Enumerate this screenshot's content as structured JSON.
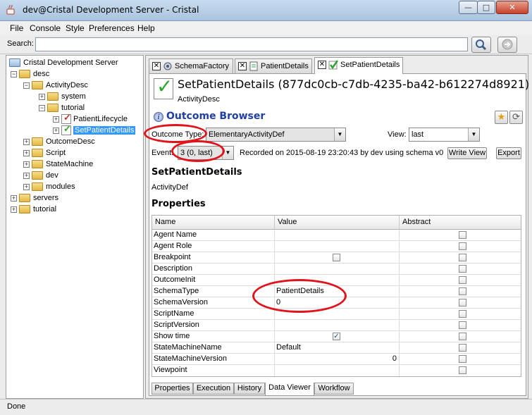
{
  "window": {
    "title": "dev@Cristal Development Server - Cristal",
    "buttons": {
      "minimize": "—",
      "maximize": "□",
      "close": "✕"
    }
  },
  "menubar": {
    "items": [
      "File",
      "Console",
      "Style",
      "Preferences",
      "Help"
    ]
  },
  "search": {
    "label": "Search:",
    "value": "",
    "placeholder": ""
  },
  "tree": {
    "root": "Cristal Development Server",
    "nodes": [
      {
        "label": "desc"
      },
      {
        "label": "ActivityDesc"
      },
      {
        "label": "system"
      },
      {
        "label": "tutorial"
      },
      {
        "label": "PatientLifecycle"
      },
      {
        "label": "SetPatientDetails"
      },
      {
        "label": "OutcomeDesc"
      },
      {
        "label": "Script"
      },
      {
        "label": "StateMachine"
      },
      {
        "label": "dev"
      },
      {
        "label": "modules"
      },
      {
        "label": "servers"
      },
      {
        "label": "tutorial"
      }
    ]
  },
  "tabs": [
    {
      "label": "SchemaFactory",
      "close": "✕"
    },
    {
      "label": "PatientDetails",
      "close": "✕"
    },
    {
      "label": "SetPatientDetails",
      "close": "✕"
    }
  ],
  "header": {
    "title": "SetPatientDetails (877dc0cb-c7db-4235-ba42-b612274d8921)",
    "subtitle": "ActivityDesc"
  },
  "outcome_browser": {
    "title": "Outcome Browser",
    "info_glyph": "i",
    "star_glyph": "★",
    "refresh_glyph": "⟳",
    "outcome_type_label": "Outcome Type:",
    "outcome_type_value": "ElementaryActivityDef",
    "view_label": "View:",
    "view_value": "last",
    "event_label": "Event:",
    "event_value": "3 (0, last)",
    "recorded_text": "Recorded on 2015-08-19 23:20:43 by dev using schema v0",
    "write_view_label": "Write View",
    "export_label": "Export",
    "dropdown_glyph": "▼"
  },
  "record": {
    "name": "SetPatientDetails",
    "type": "ActivityDef"
  },
  "properties": {
    "heading": "Properties",
    "columns": [
      "Name",
      "Value",
      "Abstract"
    ],
    "rows": [
      {
        "name": "Agent Name",
        "value": ""
      },
      {
        "name": "Agent Role",
        "value": ""
      },
      {
        "name": "Breakpoint",
        "value": ""
      },
      {
        "name": "Description",
        "value": ""
      },
      {
        "name": "OutcomeInit",
        "value": ""
      },
      {
        "name": "SchemaType",
        "value": "PatientDetails"
      },
      {
        "name": "SchemaVersion",
        "value": "0"
      },
      {
        "name": "ScriptName",
        "value": ""
      },
      {
        "name": "ScriptVersion",
        "value": ""
      },
      {
        "name": "Show time",
        "value": ""
      },
      {
        "name": "StateMachineName",
        "value": "Default"
      },
      {
        "name": "StateMachineVersion",
        "value": "0"
      },
      {
        "name": "Viewpoint",
        "value": ""
      }
    ],
    "checkmark": "✓"
  },
  "bottom_tabs": [
    "Properties",
    "Execution",
    "History",
    "Data Viewer",
    "Workflow"
  ],
  "status": {
    "text": "Done"
  }
}
